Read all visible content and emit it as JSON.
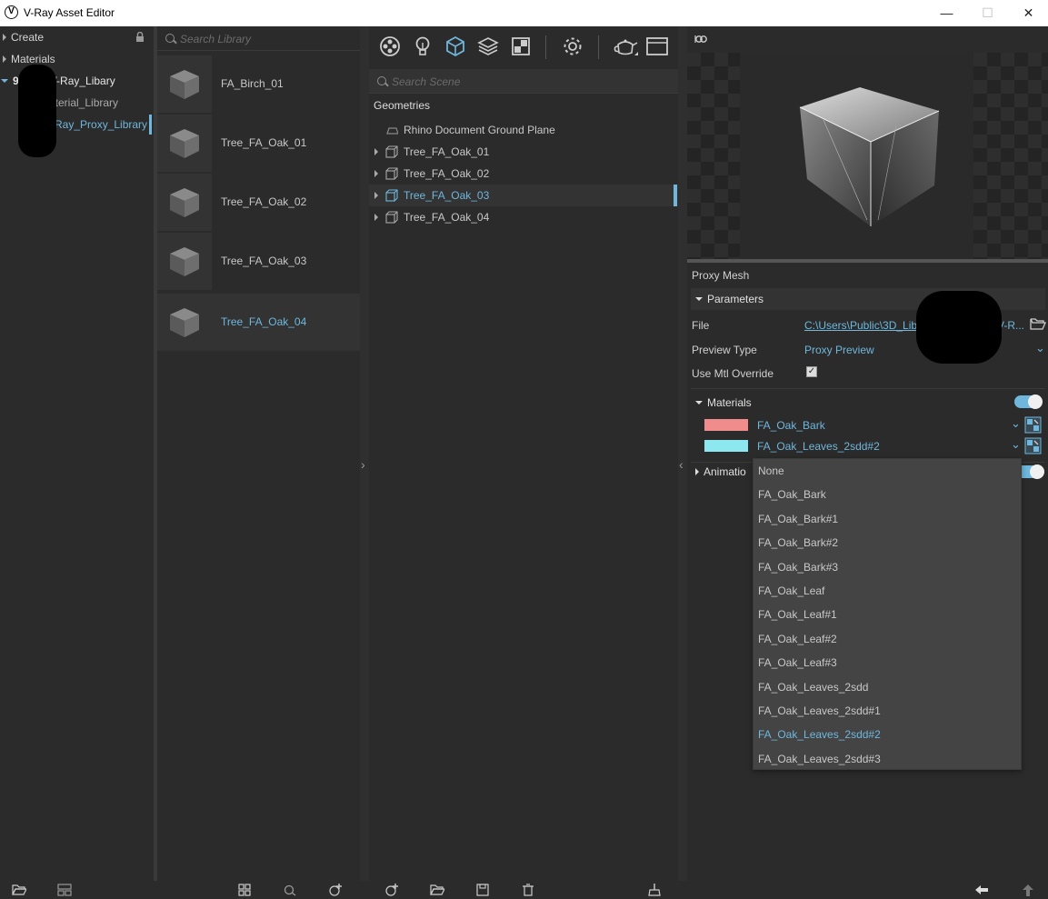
{
  "window": {
    "title": "V-Ray Asset Editor",
    "logo_glyph": "V",
    "minimize_glyph": "—",
    "maximize_glyph": "☐",
    "close_glyph": "✕"
  },
  "sidebar": {
    "items": [
      {
        "label": "Create",
        "expanded": false
      },
      {
        "label": "Materials",
        "expanded": false
      },
      {
        "label": "V-Ray_Libary",
        "prefix": "9",
        "expanded": true
      },
      {
        "label": "aterial_Library"
      },
      {
        "label": "Ray_Proxy_Library",
        "selected": true
      }
    ]
  },
  "library": {
    "search_placeholder": "Search Library",
    "items": [
      {
        "label": "FA_Birch_01"
      },
      {
        "label": "Tree_FA_Oak_01"
      },
      {
        "label": "Tree_FA_Oak_02"
      },
      {
        "label": "Tree_FA_Oak_03"
      },
      {
        "label": "Tree_FA_Oak_04",
        "selected": true
      }
    ]
  },
  "scene": {
    "toolbar_icons": [
      "materials-icon",
      "lights-icon",
      "geometry-icon",
      "layers-icon",
      "textures-icon",
      "settings-icon",
      "render-teapot-icon",
      "frame-buffer-icon"
    ],
    "search_placeholder": "Search Scene",
    "section_title": "Geometries",
    "items": [
      {
        "label": "Rhino Document Ground Plane",
        "expandable": false
      },
      {
        "label": "Tree_FA_Oak_01",
        "expandable": true
      },
      {
        "label": "Tree_FA_Oak_02",
        "expandable": true
      },
      {
        "label": "Tree_FA_Oak_03",
        "expandable": true,
        "selected": true
      },
      {
        "label": "Tree_FA_Oak_04",
        "expandable": true
      }
    ]
  },
  "properties": {
    "object_type": "Proxy Mesh",
    "parameters_header": "Parameters",
    "file_label": "File",
    "file_value": "C:\\Users\\Public\\3D_Libr",
    "file_value_tail": "V-R...",
    "preview_type_label": "Preview Type",
    "preview_type_value": "Proxy Preview",
    "use_mtl_override_label": "Use Mtl Override",
    "use_mtl_override_checked": "✓",
    "materials_header": "Materials",
    "materials": [
      {
        "name": "FA_Oak_Bark",
        "color": "#f08c8c"
      },
      {
        "name": "FA_Oak_Leaves_2sdd#2",
        "color": "#8ce8ee"
      }
    ],
    "animation_header": "Animatio"
  },
  "dropdown": {
    "options": [
      "None",
      "FA_Oak_Bark",
      "FA_Oak_Bark#1",
      "FA_Oak_Bark#2",
      "FA_Oak_Bark#3",
      "FA_Oak_Leaf",
      "FA_Oak_Leaf#1",
      "FA_Oak_Leaf#2",
      "FA_Oak_Leaf#3",
      "FA_Oak_Leaves_2sdd",
      "FA_Oak_Leaves_2sdd#1",
      "FA_Oak_Leaves_2sdd#2",
      "FA_Oak_Leaves_2sdd#3"
    ],
    "selected": "FA_Oak_Leaves_2sdd#2"
  },
  "colors": {
    "accent": "#6fb7dc",
    "panel": "#2b2b2b",
    "dropdown_bg": "#444444"
  }
}
